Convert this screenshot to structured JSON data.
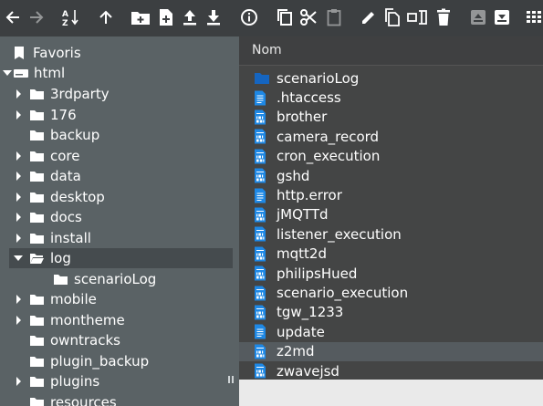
{
  "colors": {
    "toolbar_bg": "#3c3f41",
    "sidebar_bg": "#5a6265",
    "main_bg": "#444545",
    "folder_blue": "#1565c0",
    "file_blue": "#1e88e5",
    "selected_row": "#454b4e",
    "hover_row": "#555b5f"
  },
  "toolbar": {
    "icons": [
      "back-arrow-icon",
      "forward-arrow-icon",
      "sort-az-icon",
      "parent-folder-icon",
      "new-folder-icon",
      "new-file-icon",
      "upload-icon",
      "download-icon",
      "info-icon",
      "copy-icon",
      "cut-icon",
      "paste-icon",
      "rename-icon",
      "duplicate-icon",
      "extract-icon",
      "delete-icon",
      "archive-icon",
      "unarchive-icon",
      "grid-view-icon"
    ]
  },
  "sidebar": {
    "favorites_label": "Favoris",
    "root_label": "html",
    "items": [
      {
        "label": "3rdparty",
        "has_children": true
      },
      {
        "label": "176",
        "has_children": true
      },
      {
        "label": "backup",
        "has_children": false
      },
      {
        "label": "core",
        "has_children": true
      },
      {
        "label": "data",
        "has_children": true
      },
      {
        "label": "desktop",
        "has_children": true
      },
      {
        "label": "docs",
        "has_children": true
      },
      {
        "label": "install",
        "has_children": true
      },
      {
        "label": "log",
        "has_children": true,
        "expanded": true,
        "selected": true
      },
      {
        "label": "scenarioLog",
        "has_children": false,
        "child": true
      },
      {
        "label": "mobile",
        "has_children": true
      },
      {
        "label": "montheme",
        "has_children": true
      },
      {
        "label": "owntracks",
        "has_children": false
      },
      {
        "label": "plugin_backup",
        "has_children": false
      },
      {
        "label": "plugins",
        "has_children": true
      },
      {
        "label": "resources",
        "has_children": false
      }
    ]
  },
  "main": {
    "column_header": "Nom",
    "files": [
      {
        "name": "scenarioLog",
        "type": "folder"
      },
      {
        "name": ".htaccess",
        "type": "text"
      },
      {
        "name": "brother",
        "type": "binary"
      },
      {
        "name": "camera_record",
        "type": "binary"
      },
      {
        "name": "cron_execution",
        "type": "binary"
      },
      {
        "name": "gshd",
        "type": "binary"
      },
      {
        "name": "http.error",
        "type": "text"
      },
      {
        "name": "jMQTTd",
        "type": "binary"
      },
      {
        "name": "listener_execution",
        "type": "binary"
      },
      {
        "name": "mqtt2d",
        "type": "binary"
      },
      {
        "name": "philipsHued",
        "type": "binary"
      },
      {
        "name": "scenario_execution",
        "type": "binary"
      },
      {
        "name": "tgw_1233",
        "type": "binary"
      },
      {
        "name": "update",
        "type": "text"
      },
      {
        "name": "z2md",
        "type": "binary",
        "highlighted": true
      },
      {
        "name": "zwavejsd",
        "type": "binary"
      }
    ]
  }
}
